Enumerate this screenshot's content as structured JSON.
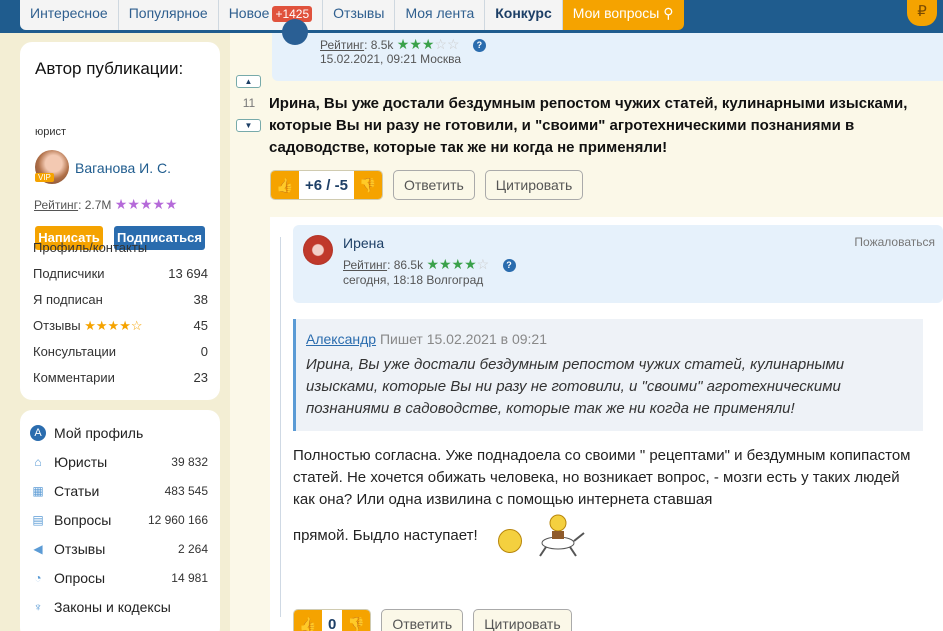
{
  "nav": {
    "tabs": [
      "Интересное",
      "Популярное",
      "Новое",
      "Отзывы",
      "Моя лента",
      "Конкурс",
      "Мои вопросы"
    ],
    "new_count": "+1425",
    "coin": "₽"
  },
  "author": {
    "title": "Автор публикации:",
    "role": "юрист",
    "vip": "VIP",
    "name": "Ваганова И. С.",
    "rating_label": "Рейтинг",
    "rating_value": ": 2.7M",
    "stars": "★★★★★",
    "write_btn": "Написать",
    "subscribe_btn": "Подписаться",
    "profile_contacts": "Профиль/контакты",
    "stats": [
      {
        "label": "Подписчики",
        "value": "13 694"
      },
      {
        "label": "Я подписан",
        "value": "38"
      },
      {
        "label": "Отзывы",
        "value": "45",
        "stars": "★★★★☆"
      },
      {
        "label": "Консультации",
        "value": "0"
      },
      {
        "label": "Комментарии",
        "value": "23"
      }
    ]
  },
  "menu": [
    {
      "label": "Мой профиль",
      "icon": "A"
    },
    {
      "label": "Юристы",
      "value": "39 832"
    },
    {
      "label": "Статьи",
      "value": "483 545"
    },
    {
      "label": "Вопросы",
      "value": "12 960 166"
    },
    {
      "label": "Отзывы",
      "value": "2 264"
    },
    {
      "label": "Опросы",
      "value": "14 981"
    },
    {
      "label": "Законы и кодексы"
    }
  ],
  "prev_comment": {
    "rating_label": "Рейтинг",
    "rating_value": ": 8.5k",
    "date": "15.02.2021, 09:21  Москва"
  },
  "comment": {
    "vote_count": "11",
    "text": "Ирина, Вы уже достали бездумным репостом чужих статей, кулинарными изысками, которые Вы ни разу не готовили, и \"своими\" агротехническими познаниями в садоводстве, которые так же ни когда не применяли!",
    "score": "+6 / -5",
    "reply_btn": "Ответить",
    "quote_btn": "Цитировать"
  },
  "reply": {
    "author": "Ирена",
    "complain": "Пожаловаться",
    "rating_label": "Рейтинг",
    "rating_value": ": 86.5k",
    "date": "сегодня, 18:18  Волгоград",
    "quote_author": "Александр",
    "quote_meta": " Пишет 15.02.2021 в 09:21",
    "quote_text": "Ирина, Вы уже достали бездумным репостом чужих статей, кулинарными изысками, которые Вы ни разу не готовили, и \"своими\" агротехническими познаниями в садоводстве, которые так же ни когда не применяли!",
    "text": "Полностью согласна. Уже поднадоела со своими \" рецептами\" и бездумным копипастом статей. Не хочется обижать человека, но возникает вопрос, - мозги есть у таких людей как она? Или одна извилина с помощью интернета ставшая",
    "text_end": "прямой. Быдло наступает!",
    "score": "0",
    "reply_btn": "Ответить",
    "quote_btn": "Цитировать"
  }
}
